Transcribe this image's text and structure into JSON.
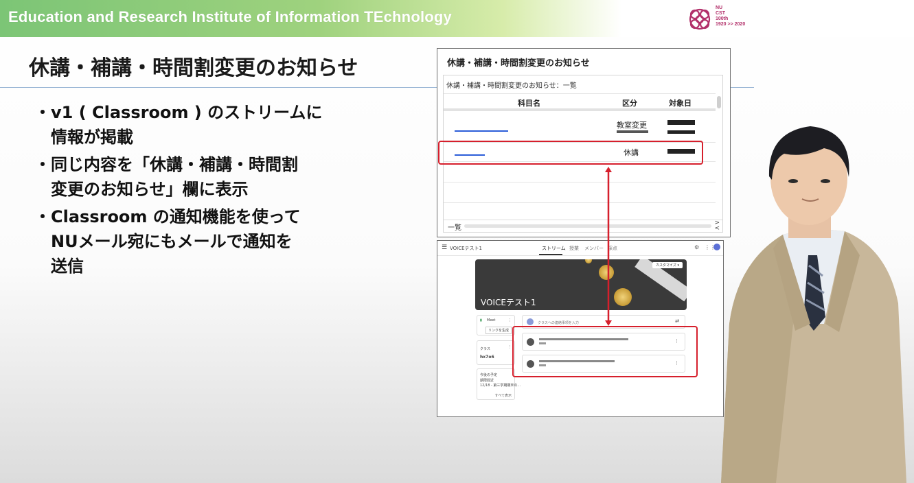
{
  "header": {
    "banner_title": "Education and Research Institute of Information TEchnology",
    "logo_text": "NU\nCST\n100th\n1920 >> 2020",
    "colors": {
      "banner_green": "#7cc576",
      "logo_magenta": "#b2306a"
    }
  },
  "slide": {
    "title": "休講・補講・時間割変更のお知らせ",
    "bullets": [
      {
        "marker": "・",
        "text": "v1 ( Classroom ) のストリームに\n情報が掲載"
      },
      {
        "marker": "・",
        "text": "同じ内容を「休講・補講・時間割\n変更のお知らせ」欄に表示"
      },
      {
        "marker": "・",
        "text": "Classroom の通知機能を使って\nNUメール宛にもメールで通知を\n送信"
      }
    ]
  },
  "notice_panel": {
    "title": "休講・補講・時間割変更のお知らせ",
    "subtitle": "休講・補講・時間割変更のお知らせ：一覧",
    "columns": [
      "科目名",
      "区分",
      "対象日"
    ],
    "rows": [
      {
        "category": "教室変更"
      },
      {
        "category": "休講"
      }
    ],
    "footer_tab": "一覧",
    "scroll_arrows": ">\n<"
  },
  "classroom_panel": {
    "menu_icon": "☰",
    "class_name": "VOICEテスト1",
    "tabs": [
      "ストリーム",
      "授業",
      "メンバー",
      "採点"
    ],
    "banner_title": "VOICEテスト1",
    "customize_label": "カスタマイズ ▾",
    "meet_label": "Meet",
    "meet_link_button": "リンクを生成",
    "announce_placeholder": "クラスへの連絡事項を入力",
    "code_label": "クラス",
    "code_value": "hx7o6",
    "upcoming_label": "今後の予定",
    "upcoming_text": "期限間近\n12/18 - 第三学期期末の...",
    "view_all": "すべて表示",
    "icons": [
      "menu-icon",
      "help-icon",
      "apps-icon",
      "account-icon"
    ]
  },
  "colors": {
    "highlight_red": "#d61f2c",
    "link_blue": "#2b5dd8"
  }
}
